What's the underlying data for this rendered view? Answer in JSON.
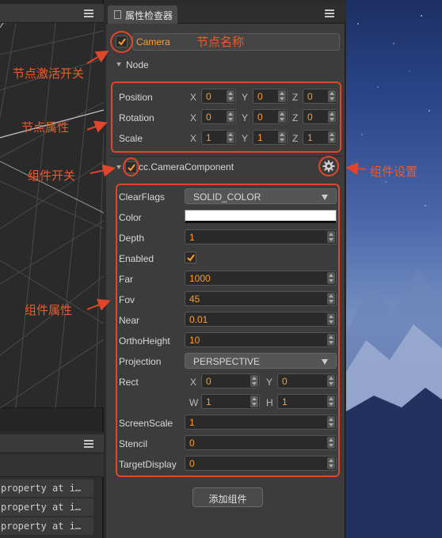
{
  "inspector": {
    "tab_label": "属性检查器",
    "node_name": "Camera",
    "node_section": "Node",
    "transform": {
      "position": {
        "label": "Position",
        "x": "0",
        "y": "0",
        "z": "0"
      },
      "rotation": {
        "label": "Rotation",
        "x": "0",
        "y": "0",
        "z": "0"
      },
      "scale": {
        "label": "Scale",
        "x": "1",
        "y": "1",
        "z": "1"
      }
    },
    "axis_labels": {
      "x": "X",
      "y": "Y",
      "z": "Z",
      "w": "W",
      "h": "H"
    },
    "component": {
      "name": "cc.CameraComponent",
      "props": {
        "clear_flags": {
          "label": "ClearFlags",
          "value": "SOLID_COLOR"
        },
        "color": {
          "label": "Color",
          "value": "#ffffff"
        },
        "depth": {
          "label": "Depth",
          "value": "1"
        },
        "enabled": {
          "label": "Enabled"
        },
        "far": {
          "label": "Far",
          "value": "1000"
        },
        "fov": {
          "label": "Fov",
          "value": "45"
        },
        "near": {
          "label": "Near",
          "value": "0.01"
        },
        "ortho_height": {
          "label": "OrthoHeight",
          "value": "10"
        },
        "projection": {
          "label": "Projection",
          "value": "PERSPECTIVE"
        },
        "rect": {
          "label": "Rect",
          "x": "0",
          "y": "0",
          "w": "1",
          "h": "1"
        },
        "screen_scale": {
          "label": "ScreenScale",
          "value": "1"
        },
        "stencil": {
          "label": "Stencil",
          "value": "0"
        },
        "target_display": {
          "label": "TargetDisplay",
          "value": "0"
        }
      }
    },
    "add_component_label": "添加组件"
  },
  "console": {
    "lines": [
      "property at i…",
      "property at i…",
      "property at i…"
    ]
  },
  "annotations": {
    "node_name": "节点名称",
    "node_active": "节点激活开关",
    "node_props": "节点属性",
    "component_toggle": "组件开关",
    "component_settings": "组件设置",
    "component_props": "组件属性"
  },
  "colors": {
    "accent": "#ff9c2b",
    "annotation": "#e0462a"
  }
}
